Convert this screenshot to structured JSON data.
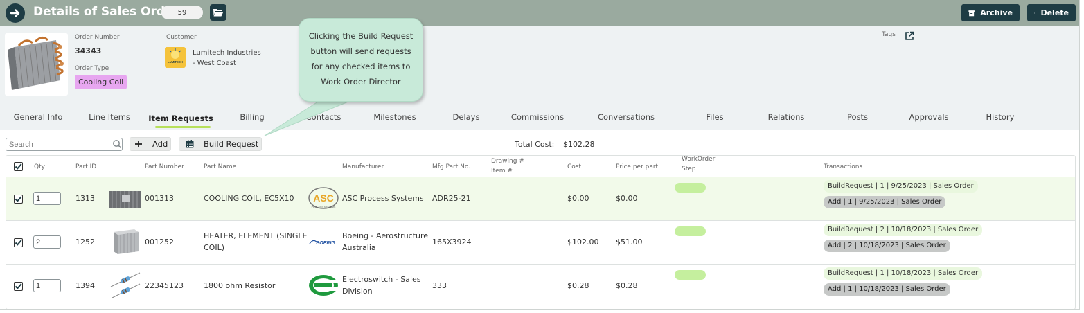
{
  "header": {
    "title": "Details of Sales Order",
    "count": "59",
    "archive_label": "Archive",
    "delete_label": "Delete"
  },
  "summary": {
    "order_number_label": "Order Number",
    "order_number": "34343",
    "order_type_label": "Order Type",
    "order_type": "Cooling Coil",
    "customer_label": "Customer",
    "customer_name_line1": "Lumitech Industries",
    "customer_name_line2": "- West Coast",
    "customer_logo_text": "LUMITECH",
    "tags_label": "Tags"
  },
  "tooltip": {
    "lines": [
      "Clicking the Build Request",
      "button will send requests",
      "for any checked items to",
      "Work Order Director"
    ]
  },
  "tabs": [
    {
      "label": "General Info"
    },
    {
      "label": "Line Items"
    },
    {
      "label": "Item Requests",
      "active": true
    },
    {
      "label": "Billing"
    },
    {
      "label": "Contacts"
    },
    {
      "label": "Milestones"
    },
    {
      "label": "Delays"
    },
    {
      "label": "Commissions"
    },
    {
      "label": "Conversations"
    },
    {
      "label": "Files"
    },
    {
      "label": "Relations"
    },
    {
      "label": "Posts"
    },
    {
      "label": "Approvals"
    },
    {
      "label": "History"
    }
  ],
  "toolbar": {
    "search_placeholder": "Search",
    "add_label": "Add",
    "build_request_label": "Build Request",
    "total_cost_label": "Total Cost:",
    "total_cost_value": "$102.28"
  },
  "table": {
    "headers": {
      "qty": "Qty",
      "part_id": "Part ID",
      "part_number": "Part Number",
      "part_name": "Part Name",
      "manufacturer": "Manufacturer",
      "mfg_part_no": "Mfg Part No.",
      "drawing_line1": "Drawing #",
      "drawing_line2": "Item #",
      "cost": "Cost",
      "price_per_part": "Price per part",
      "workorder_line1": "WorkOrder",
      "workorder_line2": "Step",
      "transactions": "Transactions"
    },
    "rows": [
      {
        "checked": true,
        "qty": "1",
        "part_id": "1313",
        "part_number": "001313",
        "part_name_line1": "COOLING COIL, EC5X10",
        "part_name_line2": "",
        "manufacturer_line1": "ASC Process Systems",
        "manufacturer_line2": "",
        "mfg_part_no": "ADR25-21",
        "cost": "$0.00",
        "price_per_part": "$0.00",
        "tx1": "BuildRequest | 1 | 9/25/2023 | Sales Order",
        "tx2": "Add | 1 | 9/25/2023 | Sales Order"
      },
      {
        "checked": true,
        "qty": "2",
        "part_id": "1252",
        "part_number": "001252",
        "part_name_line1": "HEATER, ELEMENT (SINGLE",
        "part_name_line2": "COIL)",
        "manufacturer_line1": "Boeing - Aerostructure",
        "manufacturer_line2": "Australia",
        "mfg_part_no": "165X3924",
        "cost": "$102.00",
        "price_per_part": "$51.00",
        "tx1": "BuildRequest | 2 | 10/18/2023 | Sales Order",
        "tx2": "Add | 2 | 10/18/2023 | Sales Order"
      },
      {
        "checked": true,
        "qty": "1",
        "part_id": "1394",
        "part_number": "22345123",
        "part_name_line1": "1800 ohm Resistor",
        "part_name_line2": "",
        "manufacturer_line1": "Electroswitch - Sales",
        "manufacturer_line2": "Division",
        "mfg_part_no": "333",
        "cost": "$0.28",
        "price_per_part": "$0.28",
        "tx1": "BuildRequest | 1 | 10/18/2023 | Sales Order",
        "tx2": "Add | 1 | 10/18/2023 | Sales Order"
      }
    ]
  },
  "logos": {
    "asc": "ASC",
    "asc_sub": "PROCESS SYSTEMS",
    "boeing": "BOEING"
  },
  "colors": {
    "header_bg": "#9aaa9f",
    "dark_button": "#1e3c44",
    "summary_bg": "#eef2f3",
    "order_type_badge": "#e7a6f0",
    "tooltip_bg": "#c8ead9",
    "tab_underline": "#b7e05b",
    "row_highlight": "#f2faea",
    "workorder_pill": "#c5ef9e"
  }
}
